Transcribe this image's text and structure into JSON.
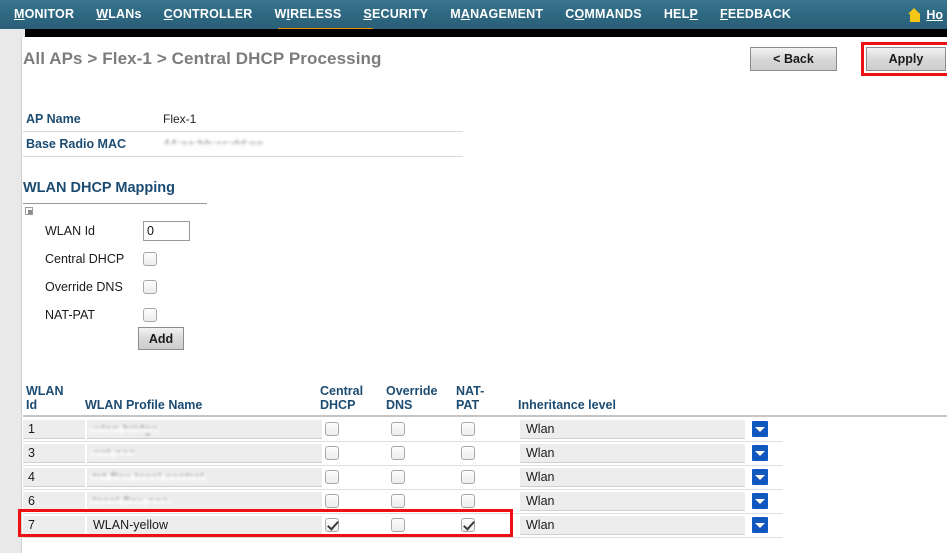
{
  "nav": {
    "items": [
      {
        "label": "MONITOR",
        "underline_char": "M",
        "active": false
      },
      {
        "label": "WLANs",
        "underline_char": "W",
        "active": false
      },
      {
        "label": "CONTROLLER",
        "underline_char": "C",
        "active": false
      },
      {
        "label": "WIRELESS",
        "underline_char": "I",
        "active": true
      },
      {
        "label": "SECURITY",
        "underline_char": "S",
        "active": false
      },
      {
        "label": "MANAGEMENT",
        "underline_char": "A",
        "active": false
      },
      {
        "label": "COMMANDS",
        "underline_char": "O",
        "active": false
      },
      {
        "label": "HELP",
        "underline_char": "P",
        "active": false
      },
      {
        "label": "FEEDBACK",
        "underline_char": "F",
        "active": false
      }
    ],
    "home_label": "Ho",
    "home_icon": "home-icon",
    "active_accent_color": "#f28b00"
  },
  "header": {
    "breadcrumb": "All APs > Flex-1 > Central DHCP Processing",
    "back_label": "< Back",
    "apply_label": "Apply",
    "highlight_color": "#ee1111"
  },
  "ap_info": {
    "rows": [
      {
        "label": "AP Name",
        "value": "Flex-1",
        "redacted": false
      },
      {
        "label": "Base Radio MAC",
        "value": "44:aa:bb:cc:dd:ee",
        "redacted": true
      }
    ]
  },
  "mapping": {
    "title": "WLAN DHCP Mapping",
    "wlan_id_label": "WLAN Id",
    "wlan_id_value": "0",
    "central_dhcp_label": "Central DHCP",
    "central_dhcp_checked": false,
    "override_dns_label": "Override DNS",
    "override_dns_checked": false,
    "nat_pat_label": "NAT-PAT",
    "nat_pat_checked": false,
    "add_label": "Add"
  },
  "table": {
    "headers": {
      "id": "WLAN\nId",
      "id_line1": "WLAN",
      "id_line2": "Id",
      "name": "WLAN Profile Name",
      "central_line1": "Central",
      "central_line2": "DHCP",
      "override_line1": "Override",
      "override_line2": "DNS",
      "nat_line1": "NAT-",
      "nat_line2": "PAT",
      "inheritance": "Inheritance level"
    },
    "rows": [
      {
        "id": "1",
        "name": "wlan-bridge",
        "redacted": true,
        "central_dhcp": false,
        "override_dns": false,
        "nat_pat": false,
        "inheritance": "Wlan",
        "highlighted": false
      },
      {
        "id": "3",
        "name": "ent-aaa",
        "redacted": true,
        "central_dhcp": false,
        "override_dns": false,
        "nat_pat": false,
        "inheritance": "Wlan",
        "highlighted": false
      },
      {
        "id": "4",
        "name": "tst-flex-local-central",
        "redacted": true,
        "central_dhcp": false,
        "override_dns": false,
        "nat_pat": false,
        "inheritance": "Wlan",
        "highlighted": false
      },
      {
        "id": "6",
        "name": "local-flex-aaa",
        "redacted": true,
        "central_dhcp": false,
        "override_dns": false,
        "nat_pat": false,
        "inheritance": "Wlan",
        "highlighted": false
      },
      {
        "id": "7",
        "name": "WLAN-yellow",
        "redacted": false,
        "central_dhcp": true,
        "override_dns": false,
        "nat_pat": true,
        "inheritance": "Wlan",
        "highlighted": true
      }
    ]
  }
}
